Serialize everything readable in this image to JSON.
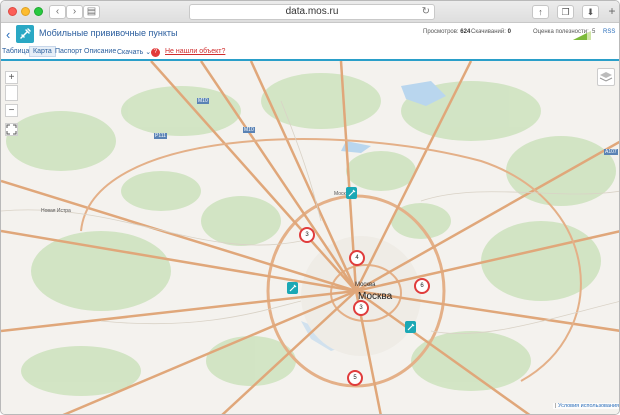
{
  "browser": {
    "url": "data.mos.ru",
    "back_icon": "‹",
    "forward_icon": "›",
    "sidebar_icon": "▤",
    "reload_icon": "↻",
    "share_icon": "↑",
    "tabs_icon": "❐",
    "download_icon": "⬇",
    "newtab_icon": "+"
  },
  "header": {
    "back_icon": "‹",
    "title": "Мобильные прививочные пункты",
    "views_label": "Просмотров:",
    "views_value": "624",
    "downloads_label": "Скачиваний:",
    "downloads_value": "0",
    "rating_label": "Оценка полезности:",
    "rating_value": "5",
    "rss_label": "RSS"
  },
  "tabs": [
    {
      "label": "Таблица"
    },
    {
      "label": "Карта"
    },
    {
      "label": "Паспорт"
    },
    {
      "label": "Описание"
    },
    {
      "label": "Скачать ⌄"
    }
  ],
  "help": {
    "icon": "?",
    "notfound_label": "Не нашли объект?"
  },
  "map": {
    "zoom_in": "+",
    "zoom_out": "−",
    "fullscreen_icon": "⛶",
    "clusters": [
      {
        "label": "3"
      },
      {
        "label": "4"
      },
      {
        "label": "6"
      },
      {
        "label": "3"
      },
      {
        "label": "5"
      }
    ],
    "city_label_small": "Москва",
    "city_label_big": "Москва",
    "road_labels": [
      "М10",
      "М10",
      "Р111",
      "А107",
      "Москва",
      "Москва",
      "Москва",
      "Новая Истра",
      "Москва",
      "Москва",
      "Москва"
    ],
    "terms_prefix": "|",
    "terms_label": "Условия использования",
    "colors": {
      "cluster": "#e03c3c",
      "pin": "#1ba8b5",
      "road": "#e0a77a"
    }
  }
}
